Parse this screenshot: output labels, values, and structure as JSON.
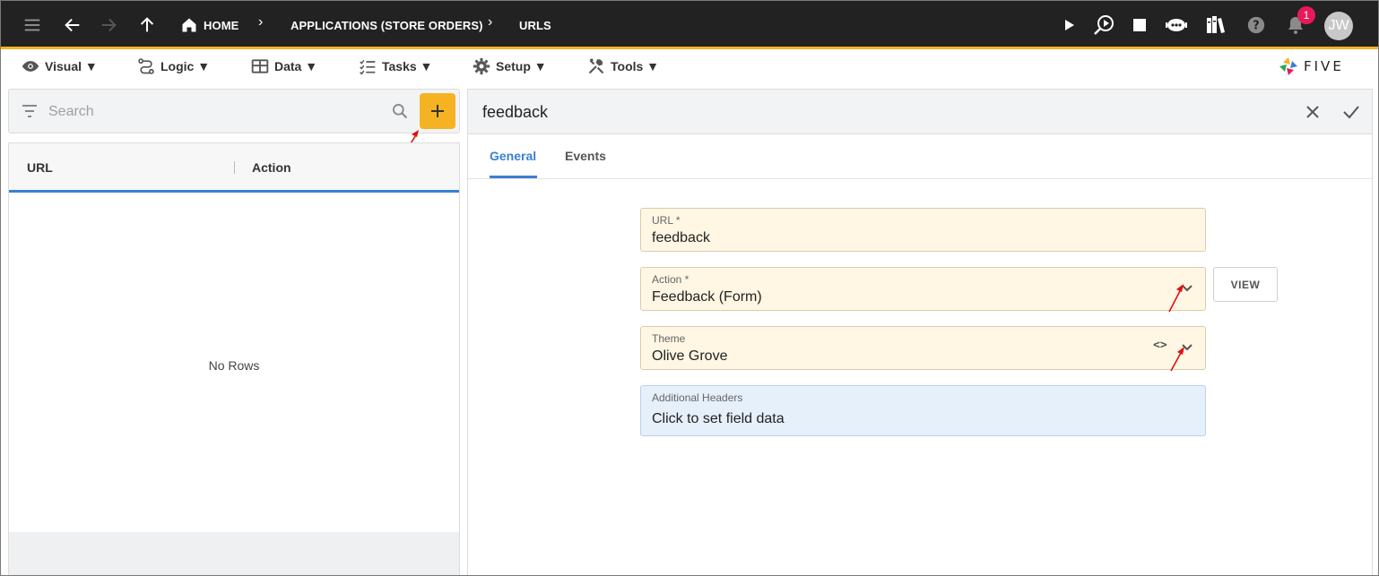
{
  "topbar": {
    "breadcrumbs": [
      "HOME",
      "APPLICATIONS (STORE ORDERS)",
      "URLS"
    ],
    "notification_count": "1",
    "avatar_initials": "JW",
    "accent_color": "#f5b324"
  },
  "menu": {
    "items": [
      {
        "label": "Visual ▼",
        "icon": "eye-icon"
      },
      {
        "label": "Logic ▼",
        "icon": "logic-icon"
      },
      {
        "label": "Data ▼",
        "icon": "table-icon"
      },
      {
        "label": "Tasks ▼",
        "icon": "tasks-icon"
      },
      {
        "label": "Setup ▼",
        "icon": "gear-icon"
      },
      {
        "label": "Tools ▼",
        "icon": "tools-icon"
      }
    ],
    "logo_text": "FIVE"
  },
  "list": {
    "search_placeholder": "Search",
    "columns": [
      "URL",
      "Action"
    ],
    "empty_text": "No Rows"
  },
  "detail": {
    "title": "feedback",
    "tabs": [
      "General",
      "Events"
    ],
    "active_tab": "General",
    "fields": {
      "url": {
        "label": "URL *",
        "value": "feedback"
      },
      "action": {
        "label": "Action *",
        "value": "Feedback (Form)"
      },
      "theme": {
        "label": "Theme",
        "value": "Olive Grove"
      },
      "headers": {
        "label": "Additional Headers",
        "value": "Click to set field data"
      }
    },
    "view_label": "VIEW"
  }
}
